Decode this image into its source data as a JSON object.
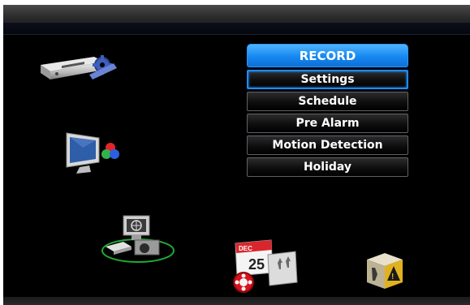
{
  "menu": {
    "header": "RECORD",
    "items": [
      {
        "label": "Settings",
        "selected": true
      },
      {
        "label": "Schedule"
      },
      {
        "label": "Pre Alarm"
      },
      {
        "label": "Motion Detection"
      },
      {
        "label": "Holiday"
      }
    ]
  },
  "icons": {
    "system": "dvr-settings-icon",
    "display": "monitor-display-icon",
    "network": "network-camera-icon",
    "record": "record-calendar-icon",
    "event": "alarm-event-icon"
  },
  "calendar_icon": {
    "month": "DEC",
    "day": "25"
  },
  "colors": {
    "accent": "#1688f0",
    "selected_border": "#1f8bff",
    "background": "#000000"
  }
}
